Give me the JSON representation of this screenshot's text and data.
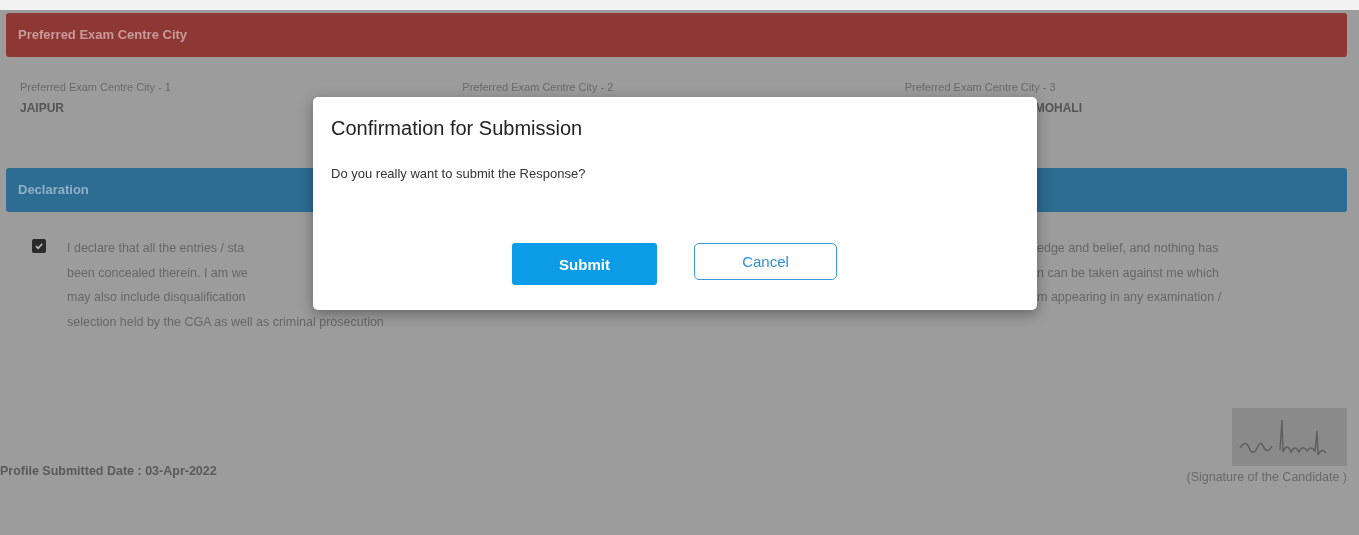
{
  "city_section": {
    "title": "Preferred Exam Centre City",
    "cities": [
      {
        "label": "Preferred Exam Centre City - 1",
        "value": "JAIPUR"
      },
      {
        "label": "Preferred Exam Centre City - 2"
      },
      {
        "label": "Preferred Exam Centre City - 3",
        "value": "MOHALI"
      }
    ]
  },
  "declaration": {
    "title": "Declaration",
    "checked": true,
    "left_lines": [
      "I declare that all the entries / sta",
      "been concealed therein. I am we",
      "may also include disqualification",
      "selection held by the CGA as well as criminal prosecution"
    ],
    "right_lines": [
      "edge and belief, and nothing has",
      "n can be taken against me which",
      "m appearing in any examination /"
    ]
  },
  "profile_date": "Profile Submitted Date : 03-Apr-2022",
  "signature_caption": "(Signature of the Candidate )",
  "dialog": {
    "title": "Confirmation for Submission",
    "message": "Do you really want to submit the Response?",
    "buttons": [
      {
        "label": "Submit",
        "kind": "primary"
      },
      {
        "label": "Cancel",
        "kind": "outline"
      }
    ]
  }
}
